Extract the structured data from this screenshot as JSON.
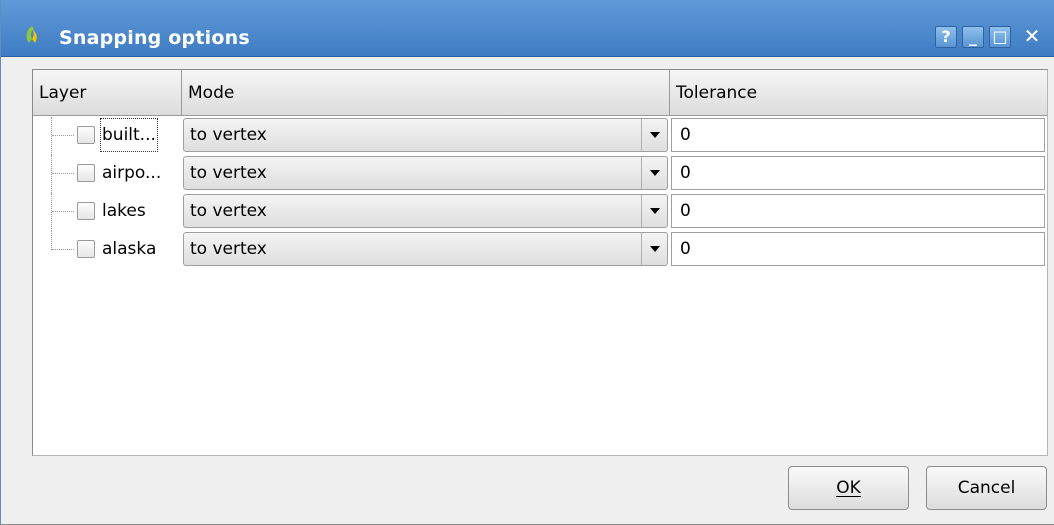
{
  "window": {
    "title": "Snapping options",
    "controls": {
      "help": "?",
      "minimize": "_",
      "maximize": "□",
      "close": "✕"
    },
    "title_color": "#4a86c8"
  },
  "table": {
    "headers": {
      "layer": "Layer",
      "mode": "Mode",
      "tolerance": "Tolerance"
    },
    "rows": [
      {
        "layer": "built...",
        "checked": false,
        "mode": "to vertex",
        "tolerance": "0"
      },
      {
        "layer": "airpo...",
        "checked": false,
        "mode": "to vertex",
        "tolerance": "0"
      },
      {
        "layer": "lakes",
        "checked": false,
        "mode": "to vertex",
        "tolerance": "0"
      },
      {
        "layer": "alaska",
        "checked": false,
        "mode": "to vertex",
        "tolerance": "0"
      }
    ]
  },
  "buttons": {
    "ok": "OK",
    "cancel": "Cancel"
  },
  "icons": {
    "app": "qgis-icon",
    "dropdown": "chevron-down-icon"
  }
}
